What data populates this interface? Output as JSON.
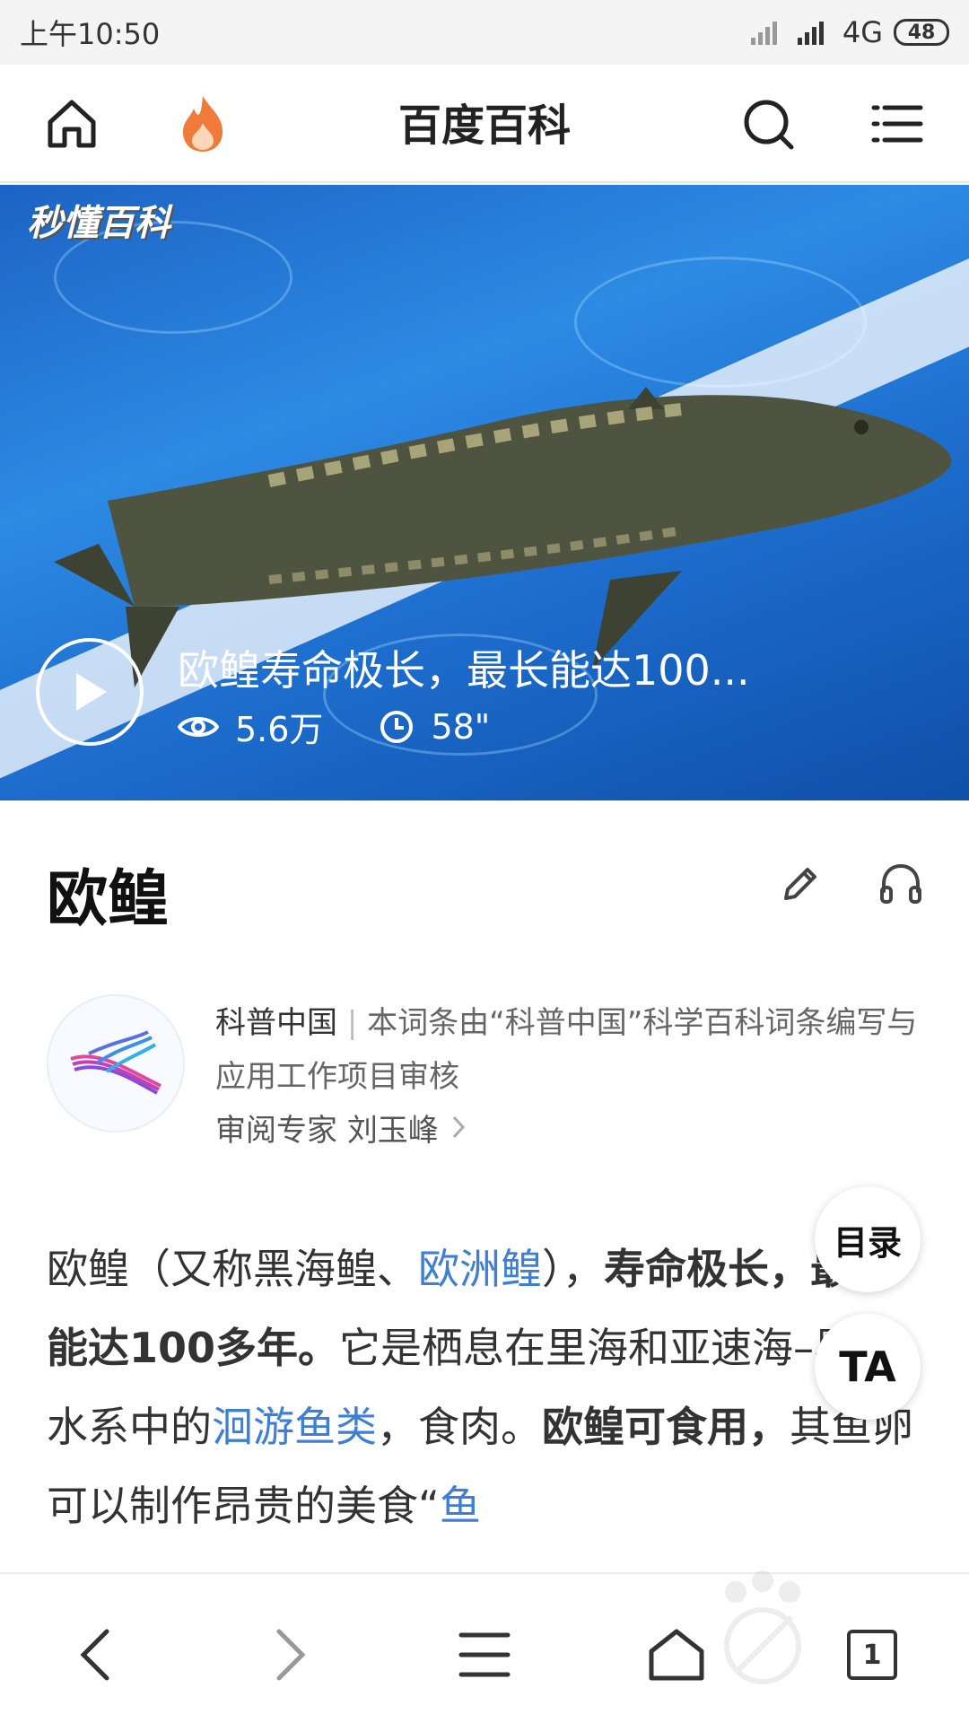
{
  "status_bar": {
    "time": "上午10:50",
    "network": "4G",
    "battery": "48"
  },
  "header": {
    "title": "百度百科"
  },
  "video": {
    "brand": "秒懂百科",
    "title": "欧鳇寿命极长，最长能达100...",
    "views": "5.6万",
    "duration": "58\""
  },
  "entry": {
    "title": "欧鳇",
    "reviewer": {
      "org": "科普中国",
      "separator": "|",
      "description": "本词条由“科普中国”科学百科词条编写与应用工作项目审核",
      "expert_label": "审阅专家",
      "expert_name": "刘玉峰"
    },
    "content": {
      "p1": "欧鳇（又称黑海鳇、",
      "link1": "欧洲鳇",
      "p2": "），",
      "b1": "寿命极长，最长能达100多年。",
      "p3": "它是栖息在里海和亚速海–黑海水系中的",
      "link2": "洄游鱼类",
      "p4": "，食肉。",
      "b2": "欧鳇可食用，",
      "p5": "其鱼卵可以制作昂贵的美食“",
      "link3": "鱼"
    }
  },
  "floating": {
    "toc_label": "目录",
    "font_label": "TA"
  },
  "bottom_bar": {
    "tab_count": "1"
  },
  "colors": {
    "accent_link": "#3d7fd6",
    "fire": "#f07a3a",
    "hero_blue": "#1e6fd0"
  }
}
